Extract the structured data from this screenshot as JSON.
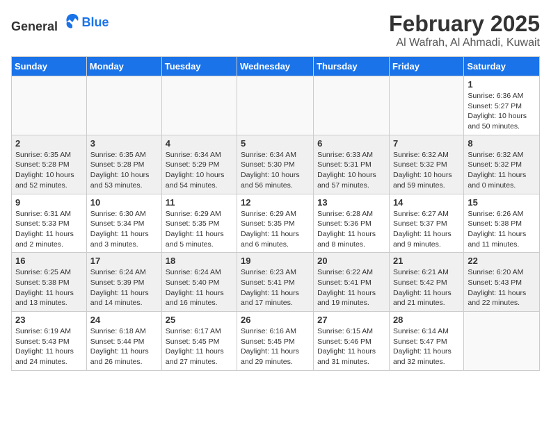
{
  "header": {
    "logo_general": "General",
    "logo_blue": "Blue",
    "month": "February 2025",
    "location": "Al Wafrah, Al Ahmadi, Kuwait"
  },
  "days_of_week": [
    "Sunday",
    "Monday",
    "Tuesday",
    "Wednesday",
    "Thursday",
    "Friday",
    "Saturday"
  ],
  "weeks": [
    [
      {
        "day": "",
        "info": ""
      },
      {
        "day": "",
        "info": ""
      },
      {
        "day": "",
        "info": ""
      },
      {
        "day": "",
        "info": ""
      },
      {
        "day": "",
        "info": ""
      },
      {
        "day": "",
        "info": ""
      },
      {
        "day": "1",
        "info": "Sunrise: 6:36 AM\nSunset: 5:27 PM\nDaylight: 10 hours\nand 50 minutes."
      }
    ],
    [
      {
        "day": "2",
        "info": "Sunrise: 6:35 AM\nSunset: 5:28 PM\nDaylight: 10 hours\nand 52 minutes."
      },
      {
        "day": "3",
        "info": "Sunrise: 6:35 AM\nSunset: 5:28 PM\nDaylight: 10 hours\nand 53 minutes."
      },
      {
        "day": "4",
        "info": "Sunrise: 6:34 AM\nSunset: 5:29 PM\nDaylight: 10 hours\nand 54 minutes."
      },
      {
        "day": "5",
        "info": "Sunrise: 6:34 AM\nSunset: 5:30 PM\nDaylight: 10 hours\nand 56 minutes."
      },
      {
        "day": "6",
        "info": "Sunrise: 6:33 AM\nSunset: 5:31 PM\nDaylight: 10 hours\nand 57 minutes."
      },
      {
        "day": "7",
        "info": "Sunrise: 6:32 AM\nSunset: 5:32 PM\nDaylight: 10 hours\nand 59 minutes."
      },
      {
        "day": "8",
        "info": "Sunrise: 6:32 AM\nSunset: 5:32 PM\nDaylight: 11 hours\nand 0 minutes."
      }
    ],
    [
      {
        "day": "9",
        "info": "Sunrise: 6:31 AM\nSunset: 5:33 PM\nDaylight: 11 hours\nand 2 minutes."
      },
      {
        "day": "10",
        "info": "Sunrise: 6:30 AM\nSunset: 5:34 PM\nDaylight: 11 hours\nand 3 minutes."
      },
      {
        "day": "11",
        "info": "Sunrise: 6:29 AM\nSunset: 5:35 PM\nDaylight: 11 hours\nand 5 minutes."
      },
      {
        "day": "12",
        "info": "Sunrise: 6:29 AM\nSunset: 5:35 PM\nDaylight: 11 hours\nand 6 minutes."
      },
      {
        "day": "13",
        "info": "Sunrise: 6:28 AM\nSunset: 5:36 PM\nDaylight: 11 hours\nand 8 minutes."
      },
      {
        "day": "14",
        "info": "Sunrise: 6:27 AM\nSunset: 5:37 PM\nDaylight: 11 hours\nand 9 minutes."
      },
      {
        "day": "15",
        "info": "Sunrise: 6:26 AM\nSunset: 5:38 PM\nDaylight: 11 hours\nand 11 minutes."
      }
    ],
    [
      {
        "day": "16",
        "info": "Sunrise: 6:25 AM\nSunset: 5:38 PM\nDaylight: 11 hours\nand 13 minutes."
      },
      {
        "day": "17",
        "info": "Sunrise: 6:24 AM\nSunset: 5:39 PM\nDaylight: 11 hours\nand 14 minutes."
      },
      {
        "day": "18",
        "info": "Sunrise: 6:24 AM\nSunset: 5:40 PM\nDaylight: 11 hours\nand 16 minutes."
      },
      {
        "day": "19",
        "info": "Sunrise: 6:23 AM\nSunset: 5:41 PM\nDaylight: 11 hours\nand 17 minutes."
      },
      {
        "day": "20",
        "info": "Sunrise: 6:22 AM\nSunset: 5:41 PM\nDaylight: 11 hours\nand 19 minutes."
      },
      {
        "day": "21",
        "info": "Sunrise: 6:21 AM\nSunset: 5:42 PM\nDaylight: 11 hours\nand 21 minutes."
      },
      {
        "day": "22",
        "info": "Sunrise: 6:20 AM\nSunset: 5:43 PM\nDaylight: 11 hours\nand 22 minutes."
      }
    ],
    [
      {
        "day": "23",
        "info": "Sunrise: 6:19 AM\nSunset: 5:43 PM\nDaylight: 11 hours\nand 24 minutes."
      },
      {
        "day": "24",
        "info": "Sunrise: 6:18 AM\nSunset: 5:44 PM\nDaylight: 11 hours\nand 26 minutes."
      },
      {
        "day": "25",
        "info": "Sunrise: 6:17 AM\nSunset: 5:45 PM\nDaylight: 11 hours\nand 27 minutes."
      },
      {
        "day": "26",
        "info": "Sunrise: 6:16 AM\nSunset: 5:45 PM\nDaylight: 11 hours\nand 29 minutes."
      },
      {
        "day": "27",
        "info": "Sunrise: 6:15 AM\nSunset: 5:46 PM\nDaylight: 11 hours\nand 31 minutes."
      },
      {
        "day": "28",
        "info": "Sunrise: 6:14 AM\nSunset: 5:47 PM\nDaylight: 11 hours\nand 32 minutes."
      },
      {
        "day": "",
        "info": ""
      }
    ]
  ]
}
